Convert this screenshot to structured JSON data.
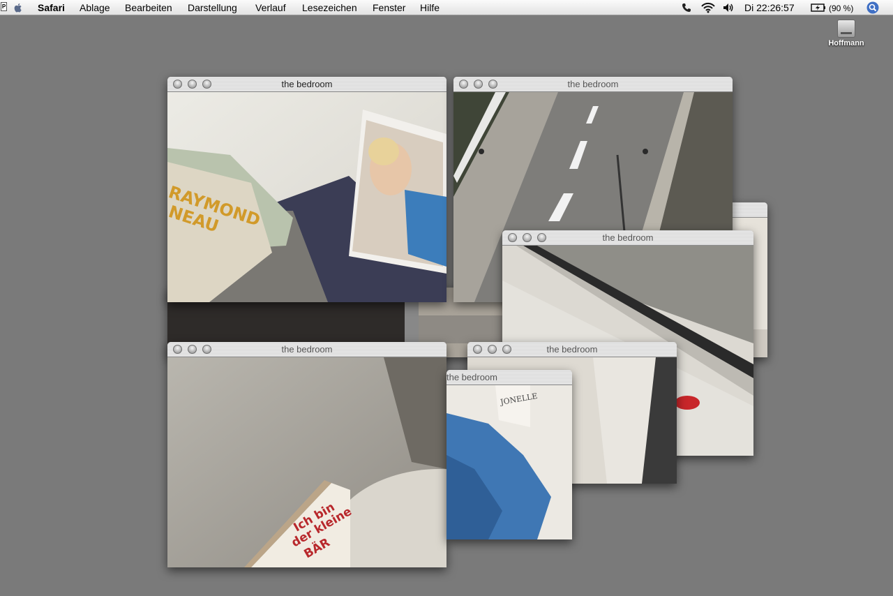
{
  "menubar": {
    "app_icon_letter": "P",
    "items": [
      "Safari",
      "Ablage",
      "Bearbeiten",
      "Darstellung",
      "Verlauf",
      "Lesezeichen",
      "Fenster",
      "Hilfe"
    ],
    "clock": "Di 22:26:57",
    "battery": "(90 %)"
  },
  "desktop": {
    "disk_label": "Hoffmann"
  },
  "windows": [
    {
      "title": "the bedroom"
    },
    {
      "title": "the bedroom"
    },
    {
      "title": "the bedroom"
    },
    {
      "title": "the bedroom"
    },
    {
      "title": "the bedroom"
    },
    {
      "title": "the bedroom"
    }
  ],
  "photo_text": {
    "book_spine_1": "RAYMOND",
    "book_spine_2": "NEAU",
    "book_cover_1": "Ich bin",
    "book_cover_2": "der kleine",
    "book_cover_3": "BÄR",
    "label": "JONELLE"
  }
}
